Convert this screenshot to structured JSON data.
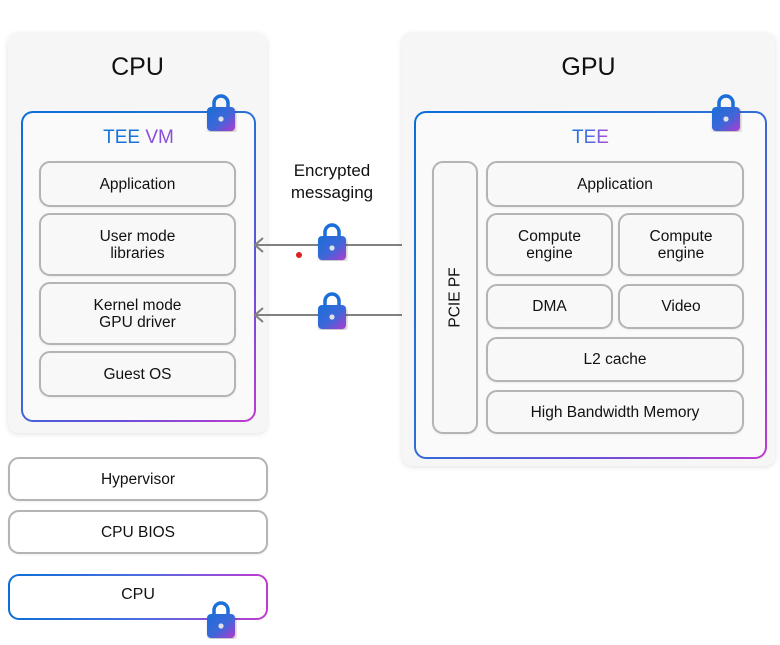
{
  "cpu_panel": {
    "title": "CPU",
    "tee_label_part1": "TEE",
    "tee_label_part2": "VM",
    "layers": [
      "Application",
      "User mode libraries",
      "Kernel mode GPU driver",
      "Guest OS"
    ]
  },
  "cpu_host_layers": [
    "Hypervisor",
    "CPU BIOS"
  ],
  "cpu_chip": {
    "label": "CPU"
  },
  "gpu_panel": {
    "title": "GPU",
    "tee_label": "TEE",
    "pcie_label": "PCIE PF",
    "application": "Application",
    "compute_engines": [
      "Compute engine",
      "Compute engine"
    ],
    "dma": "DMA",
    "video": "Video",
    "l2_cache": "L2 cache",
    "memory": "High Bandwidth Memory"
  },
  "channel": {
    "caption_line1": "Encrypted",
    "caption_line2": "messaging"
  },
  "colors": {
    "gradient_start": "#0a6fd8",
    "gradient_end": "#c13ad0",
    "arrow": "#808080",
    "box_border": "#b4b4b4",
    "marker_dot": "#e02020"
  }
}
